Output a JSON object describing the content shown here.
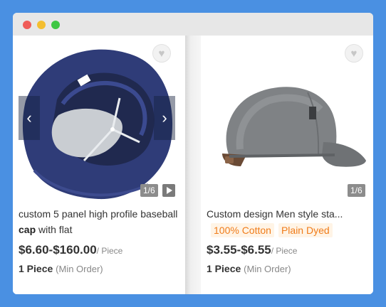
{
  "window": {
    "controls": [
      "close",
      "minimize",
      "maximize"
    ]
  },
  "products": [
    {
      "title_prefix": "custom 5 panel high profile baseball ",
      "title_bold": "cap",
      "title_suffix": " with flat",
      "price": "$6.60-$160.00",
      "price_unit": "/ Piece",
      "moq": "1 Piece",
      "moq_label": "(Min Order)",
      "image_counter": "1/6",
      "favorite_icon": "heart-icon",
      "prev_icon": "chevron-left-icon",
      "next_icon": "chevron-right-icon",
      "video_icon": "play-icon"
    },
    {
      "title": "Custom design Men style sta...",
      "tags": [
        "100% Cotton",
        "Plain Dyed"
      ],
      "price": "$3.55-$6.55",
      "price_unit": "/ Piece",
      "moq": "1 Piece",
      "moq_label": "(Min Order)",
      "image_counter": "1/6",
      "favorite_icon": "heart-icon"
    }
  ],
  "colors": {
    "background": "#4a90e2",
    "tag_text": "#f07c1a",
    "tag_bg": "#fff4e6"
  }
}
